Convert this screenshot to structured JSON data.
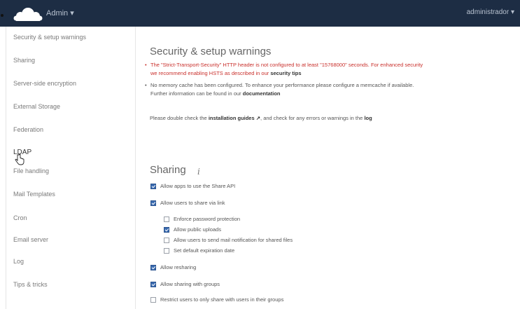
{
  "header": {
    "app_menu_label": "Admin ▾",
    "user_menu_label": "administrador ▾"
  },
  "sidebar": {
    "items": [
      {
        "label": "Security & setup warnings"
      },
      {
        "label": "Sharing"
      },
      {
        "label": "Server-side encryption"
      },
      {
        "label": "External Storage"
      },
      {
        "label": "Federation"
      },
      {
        "label": "LDAP"
      },
      {
        "label": "File handling"
      },
      {
        "label": "Mail Templates"
      },
      {
        "label": "Cron"
      },
      {
        "label": "Email server"
      },
      {
        "label": "Log"
      },
      {
        "label": "Tips & tricks"
      }
    ]
  },
  "security": {
    "title": "Security & setup warnings",
    "warning_hsts_a": "The \"Strict-Transport-Security\" HTTP header is not configured to at least \"15768000\" seconds. For enhanced security",
    "warning_hsts_b": "we recommend enabling HSTS as described in our ",
    "warning_hsts_link": "security tips",
    "warning_memcache_a": "No memory cache has been configured. To enhance your performance please configure a memcache if available.",
    "warning_memcache_b": "Further information can be found in our ",
    "warning_memcache_link": "documentation",
    "check_a": "Please double check the ",
    "check_link_guides": "installation guides ↗",
    "check_b": ", and check for any errors or warnings in the ",
    "check_link_log": "log"
  },
  "sharing": {
    "title": "Sharing",
    "info_icon": "i",
    "options": [
      {
        "label": "Allow apps to use the Share API",
        "checked": true
      },
      {
        "label": "Allow users to share via link",
        "checked": true
      },
      {
        "label": "Enforce password protection",
        "checked": false
      },
      {
        "label": "Allow public uploads",
        "checked": true
      },
      {
        "label": "Allow users to send mail notification for shared files",
        "checked": false
      },
      {
        "label": "Set default expiration date",
        "checked": false
      },
      {
        "label": "Allow resharing",
        "checked": true
      },
      {
        "label": "Allow sharing with groups",
        "checked": true
      },
      {
        "label": "Restrict users to only share with users in their groups",
        "checked": false
      }
    ]
  },
  "icons": {
    "logo": "cloud-logo-icon",
    "cursor": "hand-pointer-icon",
    "info": "info-icon"
  },
  "colors": {
    "topbar": "#1d2d44",
    "warning": "#c9302c",
    "checkbox": "#3a6bb0"
  }
}
